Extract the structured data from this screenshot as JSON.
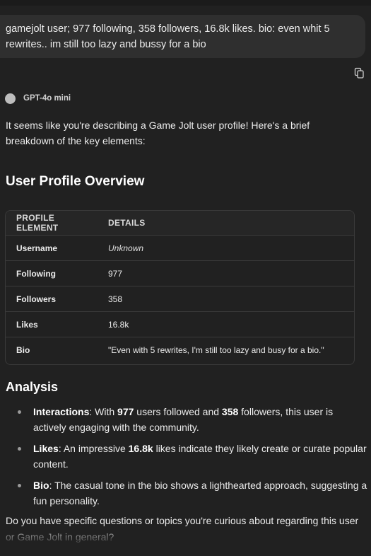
{
  "user_message": "gamejolt user; 977 following, 358 followers, 16.8k likes. bio: even whit 5 rewrites.. im still too lazy and bussy for a bio",
  "model": {
    "name": "GPT-4o mini"
  },
  "response": {
    "intro": "It seems like you're describing a Game Jolt user profile! Here's a brief breakdown of the key elements:",
    "overview_heading": "User Profile Overview",
    "table": {
      "headers": [
        "PROFILE ELEMENT",
        "DETAILS"
      ],
      "rows": [
        {
          "key": "Username",
          "value": "Unknown"
        },
        {
          "key": "Following",
          "value": "977"
        },
        {
          "key": "Followers",
          "value": "358"
        },
        {
          "key": "Likes",
          "value": "16.8k"
        },
        {
          "key": "Bio",
          "value": "\"Even with 5 rewrites, I'm still too lazy and busy for a bio.\""
        }
      ]
    },
    "analysis_heading": "Analysis",
    "analysis": [
      {
        "title": "Interactions",
        "parts": [
          ": With ",
          "977",
          " users followed and ",
          "358",
          " followers, this user is actively engaging with the community."
        ]
      },
      {
        "title": "Likes",
        "parts": [
          ": An impressive ",
          "16.8k",
          " likes indicate they likely create or curate popular content."
        ]
      },
      {
        "title": "Bio",
        "parts": [
          ": The casual tone in the bio shows a lighthearted approach, suggesting a fun personality."
        ]
      }
    ],
    "closing": "Do you have specific questions or topics you're curious about regarding this user or Game Jolt in general?"
  },
  "icons": {
    "copy": "copy-icon"
  }
}
